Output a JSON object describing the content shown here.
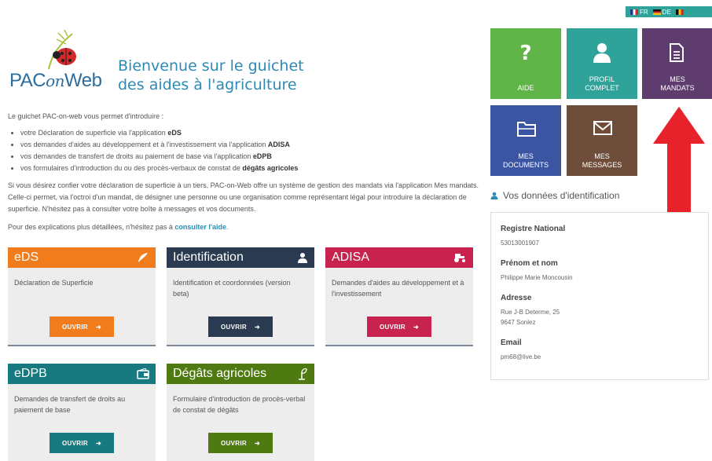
{
  "languages": [
    "FR",
    "DE"
  ],
  "logo": {
    "main": "PAC",
    "on": "on",
    "web": "Web"
  },
  "welcome": {
    "line1": "Bienvenue sur le guichet",
    "line2": "des aides à l'agriculture"
  },
  "intro": {
    "lead": "Le guichet PAC-on-web vous permet d'introduire :",
    "items": [
      {
        "text": "votre Déclaration de superficie via l'application ",
        "bold": "eDS"
      },
      {
        "text": "vos demandes d'aides au développement et à l'investissement via l'application ",
        "bold": "ADISA"
      },
      {
        "text": "vos demandes de transfert de droits au paiement de base via l'application ",
        "bold": "eDPB"
      },
      {
        "text": "vos formulaires d'introduction du ou des procès-verbaux de constat de ",
        "bold": "dégâts agricoles"
      }
    ],
    "paragraph": "Si vous désirez confier votre déclaration de superficie à un tiers, PAC-on-Web offre un système de gestion des mandats via l'application Mes mandats. Celle-ci permet, via l'octroi d'un mandat, de désigner une personne ou une organisation comme représentant légal pour introduire la déclaration de superficie. N'hésitez pas à consulter votre boîte à messages et vos documents.",
    "help_text": "Pour des explications plus détaillées, n'hésitez pas à ",
    "help_link": "consulter l'aide",
    "help_end": "."
  },
  "cards": [
    {
      "title": "eDS",
      "desc": "Déclaration de Superficie",
      "button": "OUVRIR",
      "color": "#f07c1c",
      "icon": "feather-icon"
    },
    {
      "title": "Identification",
      "desc": "Identification et coordonnées (version beta)",
      "button": "OUVRIR",
      "color": "#2a3a50",
      "icon": "user-icon"
    },
    {
      "title": "ADISA",
      "desc": "Demandes d'aides au développement et à l'investissement",
      "button": "OUVRIR",
      "color": "#c8234e",
      "icon": "tractor-icon"
    },
    {
      "title": "eDPB",
      "desc": "Demandes de transfert de droits au paiement de base",
      "button": "OUVRIR",
      "color": "#167a80",
      "icon": "wallet-icon"
    },
    {
      "title": "Dégâts agricoles",
      "desc": "Formulaire d'introduction de procès-verbal de constat de dégâts",
      "button": "OUVRIR",
      "color": "#4f7a12",
      "icon": "plant-icon"
    }
  ],
  "tiles": [
    {
      "label1": "AIDE",
      "label2": "",
      "color": "#5fb548",
      "icon": "question-icon"
    },
    {
      "label1": "PROFIL",
      "label2": "COMPLET",
      "color": "#2fa39a",
      "icon": "profile-icon"
    },
    {
      "label1": "MES",
      "label2": "MANDATS",
      "color": "#5e3d6e",
      "icon": "document-icon"
    },
    {
      "label1": "MES",
      "label2": "DOCUMENTS",
      "color": "#3b55a3",
      "icon": "folder-icon"
    },
    {
      "label1": "MES",
      "label2": "MESSAGES",
      "color": "#6e4e3b",
      "icon": "envelope-icon"
    }
  ],
  "identification": {
    "title": "Vos données d'identification",
    "fields": [
      {
        "label": "Registre National",
        "value1": "53013001907",
        "value2": ""
      },
      {
        "label": "Prénom et nom",
        "value1": "Philippe Marie Moncousin",
        "value2": ""
      },
      {
        "label": "Adresse",
        "value1": "Rue J-B Determe, 25",
        "value2": "9647 Sonlez"
      },
      {
        "label": "Email",
        "value1": "pm68@live.be",
        "value2": ""
      }
    ]
  },
  "colors": {
    "link": "#2c8ab5",
    "arrow": "#e8222a"
  }
}
